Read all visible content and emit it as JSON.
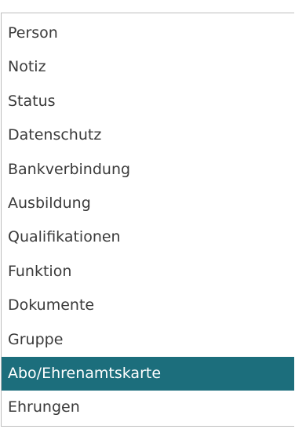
{
  "menu": {
    "items": [
      {
        "label": "Person"
      },
      {
        "label": "Notiz"
      },
      {
        "label": "Status"
      },
      {
        "label": "Datenschutz"
      },
      {
        "label": "Bankverbindung"
      },
      {
        "label": "Ausbildung"
      },
      {
        "label": "Qualifikationen"
      },
      {
        "label": "Funktion"
      },
      {
        "label": "Dokumente"
      },
      {
        "label": "Gruppe"
      },
      {
        "label": "Abo/Ehrenamtskarte"
      },
      {
        "label": "Ehrungen"
      }
    ],
    "selected_label": "Abo/Ehrenamtskarte",
    "highlight_color": "#1c6e7c"
  }
}
